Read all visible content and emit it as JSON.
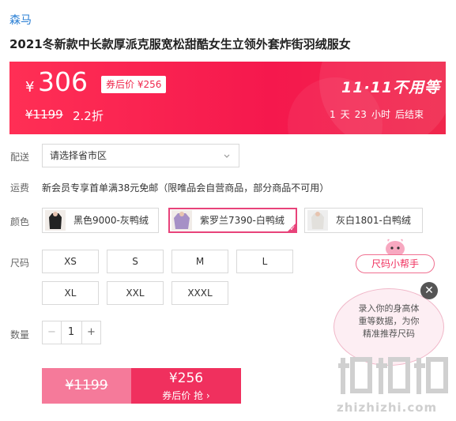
{
  "brand": "森马",
  "title": "2021冬新款中长款厚派克服宽松甜酷女生立领外套炸街羽绒服女",
  "banner": {
    "currency": "¥",
    "price": "306",
    "coupon_price": "券后价 ¥256",
    "original_price": "¥1199",
    "discount": "2.2折",
    "promo": "11·11不用等",
    "countdown": [
      "1",
      "天",
      "23",
      "小时",
      "后结束"
    ]
  },
  "delivery": {
    "label": "配送",
    "placeholder": "请选择省市区",
    "chevron_icon": "chevron-down-icon"
  },
  "shipping": {
    "label": "运费",
    "text": "新会员专享首单满38元免邮（限唯品会自营商品，部分商品不可用）"
  },
  "color": {
    "label": "颜色",
    "options": [
      {
        "name": "黑色9000-灰鸭绒",
        "selected": false
      },
      {
        "name": "紫罗兰7390-白鸭绒",
        "selected": true
      },
      {
        "name": "灰白1801-白鸭绒",
        "selected": false
      }
    ]
  },
  "size": {
    "label": "尺码",
    "options": [
      "XS",
      "S",
      "M",
      "L",
      "XL",
      "XXL",
      "XXXL"
    ]
  },
  "quantity": {
    "label": "数量",
    "minus": "−",
    "value": "1",
    "plus": "+"
  },
  "buy": {
    "original": "¥1199",
    "coupon_price": "¥256",
    "coupon_label": "券后价 抢 ›"
  },
  "size_helper": {
    "button": "尺码小帮手",
    "line1": "录入你的身高体",
    "line2": "重等数据，为你",
    "line3": "精准推荐尺码",
    "close": "✕"
  },
  "watermark": {
    "text": "zhizhizhi.com"
  },
  "colors": {
    "accent": "#f0305e",
    "brand_link": "#2a7fd4",
    "selected_border": "#e8437a"
  }
}
